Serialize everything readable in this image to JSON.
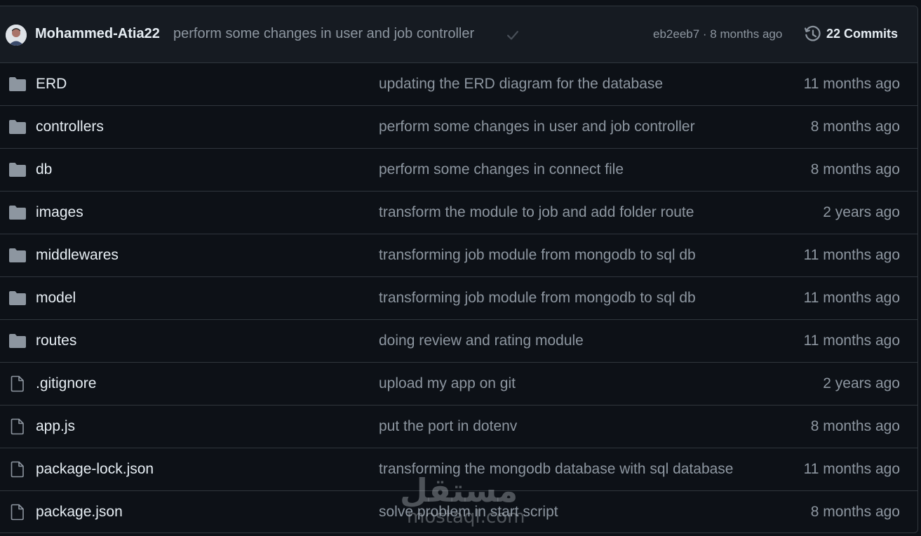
{
  "latest_commit": {
    "author": "Mohammed-Atia22",
    "message": "perform some changes in user and job controller",
    "sha_time": "eb2eeb7 · 8 months ago",
    "commits_label": "22 Commits"
  },
  "files": [
    {
      "type": "folder",
      "name": "ERD",
      "message": "updating the ERD diagram for the database",
      "age": "11 months ago"
    },
    {
      "type": "folder",
      "name": "controllers",
      "message": "perform some changes in user and job controller",
      "age": "8 months ago"
    },
    {
      "type": "folder",
      "name": "db",
      "message": "perform some changes in connect file",
      "age": "8 months ago"
    },
    {
      "type": "folder",
      "name": "images",
      "message": "transform the module to job and add folder route",
      "age": "2 years ago"
    },
    {
      "type": "folder",
      "name": "middlewares",
      "message": "transforming job module from mongodb to sql db",
      "age": "11 months ago"
    },
    {
      "type": "folder",
      "name": "model",
      "message": "transforming job module from mongodb to sql db",
      "age": "11 months ago"
    },
    {
      "type": "folder",
      "name": "routes",
      "message": "doing review and rating module",
      "age": "11 months ago"
    },
    {
      "type": "file",
      "name": ".gitignore",
      "message": "upload my app on git",
      "age": "2 years ago"
    },
    {
      "type": "file",
      "name": "app.js",
      "message": "put the port in dotenv",
      "age": "8 months ago"
    },
    {
      "type": "file",
      "name": "package-lock.json",
      "message": "transforming the mongodb database with sql database",
      "age": "11 months ago"
    },
    {
      "type": "file",
      "name": "package.json",
      "message": "solve problem in start script",
      "age": "8 months ago"
    }
  ],
  "watermark": {
    "arabic": "مستقل",
    "latin": "mostaql.com"
  },
  "colors": {
    "background": "#0d1117",
    "header": "#161b22",
    "border": "#30363d",
    "text": "#e6edf3",
    "muted": "#8d96a0",
    "icon": "#8d96a0"
  }
}
